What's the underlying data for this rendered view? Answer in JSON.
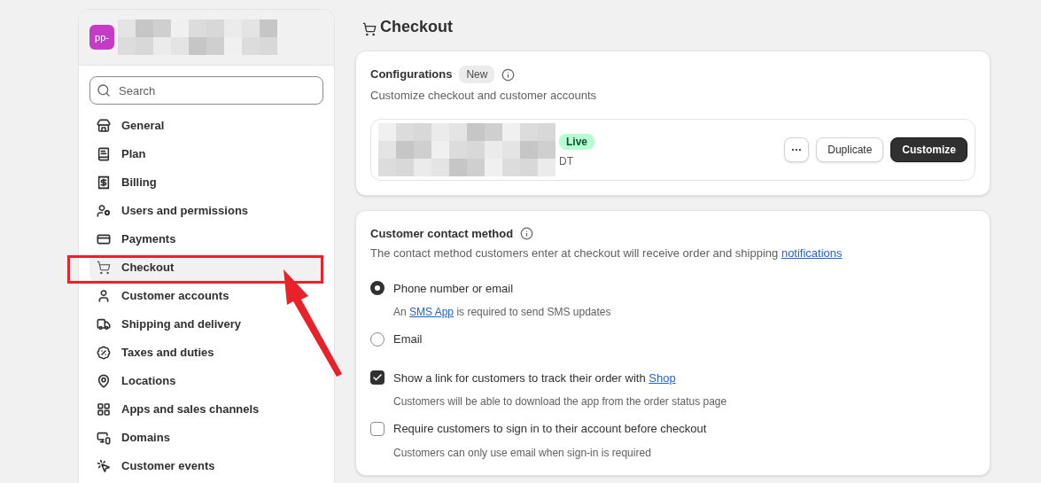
{
  "sidebar": {
    "avatar": "pp-",
    "search": {
      "placeholder": "Search"
    },
    "items": [
      {
        "label": "General",
        "selected": false
      },
      {
        "label": "Plan",
        "selected": false
      },
      {
        "label": "Billing",
        "selected": false
      },
      {
        "label": "Users and permissions",
        "selected": false
      },
      {
        "label": "Payments",
        "selected": false
      },
      {
        "label": "Checkout",
        "selected": true
      },
      {
        "label": "Customer accounts",
        "selected": false
      },
      {
        "label": "Shipping and delivery",
        "selected": false
      },
      {
        "label": "Taxes and duties",
        "selected": false
      },
      {
        "label": "Locations",
        "selected": false
      },
      {
        "label": "Apps and sales channels",
        "selected": false
      },
      {
        "label": "Domains",
        "selected": false
      },
      {
        "label": "Customer events",
        "selected": false
      }
    ]
  },
  "page": {
    "title": "Checkout",
    "configurations": {
      "title": "Configurations",
      "badge": "New",
      "subtitle": "Customize checkout and customer accounts",
      "config": {
        "status": "Live",
        "sub": "DT",
        "buttons": [
          {
            "kind": "more",
            "label": "···"
          },
          {
            "kind": "secondary",
            "label": "Duplicate"
          },
          {
            "kind": "primary",
            "label": "Customize"
          }
        ]
      }
    },
    "contact": {
      "title": "Customer contact method",
      "description": [
        {
          "text": "The contact method customers enter at checkout will receive order and shipping "
        },
        {
          "text": "notifications",
          "link": true
        }
      ],
      "options": [
        {
          "kind": "radio",
          "label": [
            {
              "text": "Phone number or email"
            }
          ],
          "selected": true,
          "help": [
            {
              "text": "An "
            },
            {
              "text": "SMS App",
              "link": true
            },
            {
              "text": " is required to send SMS updates"
            }
          ]
        },
        {
          "kind": "radio",
          "label": [
            {
              "text": "Email"
            }
          ],
          "selected": false
        },
        {
          "kind": "checkbox",
          "label": [
            {
              "text": "Show a link for customers to track their order with "
            },
            {
              "text": "Shop",
              "link": true
            }
          ],
          "checked": true,
          "help": [
            {
              "text": "Customers will be able to download the app from the order status page"
            }
          ]
        },
        {
          "kind": "checkbox",
          "label": [
            {
              "text": "Require customers to sign in to their account before checkout"
            }
          ],
          "checked": false,
          "help": [
            {
              "text": "Customers can only use email when sign-in is required"
            }
          ]
        }
      ]
    }
  }
}
